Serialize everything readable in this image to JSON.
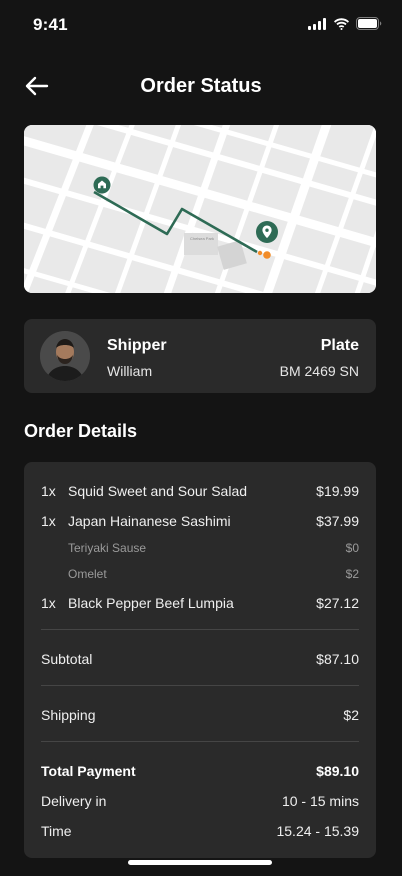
{
  "status_bar": {
    "time": "9:41"
  },
  "header": {
    "title": "Order Status"
  },
  "map": {
    "accent_color": "#2e6b55",
    "destination_color": "#f28c28",
    "park_label": "Chelsea Park"
  },
  "shipper": {
    "label": "Shipper",
    "name": "William",
    "plate_label": "Plate",
    "plate_value": "BM 2469 SN"
  },
  "order_details": {
    "title": "Order Details",
    "items": [
      {
        "qty": "1x",
        "name": "Squid Sweet and Sour Salad",
        "price": "$19.99"
      },
      {
        "qty": "1x",
        "name": "Japan Hainanese Sashimi",
        "price": "$37.99",
        "options": [
          {
            "name": "Teriyaki Sause",
            "price": "$0"
          },
          {
            "name": "Omelet",
            "price": "$2"
          }
        ]
      },
      {
        "qty": "1x",
        "name": "Black Pepper Beef Lumpia",
        "price": "$27.12"
      }
    ],
    "subtotal": {
      "label": "Subtotal",
      "value": "$87.10"
    },
    "shipping": {
      "label": "Shipping",
      "value": "$2"
    },
    "total": {
      "label": "Total Payment",
      "value": "$89.10"
    },
    "delivery": {
      "label": "Delivery in",
      "value": "10 - 15 mins"
    },
    "time": {
      "label": "Time",
      "value": "15.24 - 15.39"
    }
  }
}
